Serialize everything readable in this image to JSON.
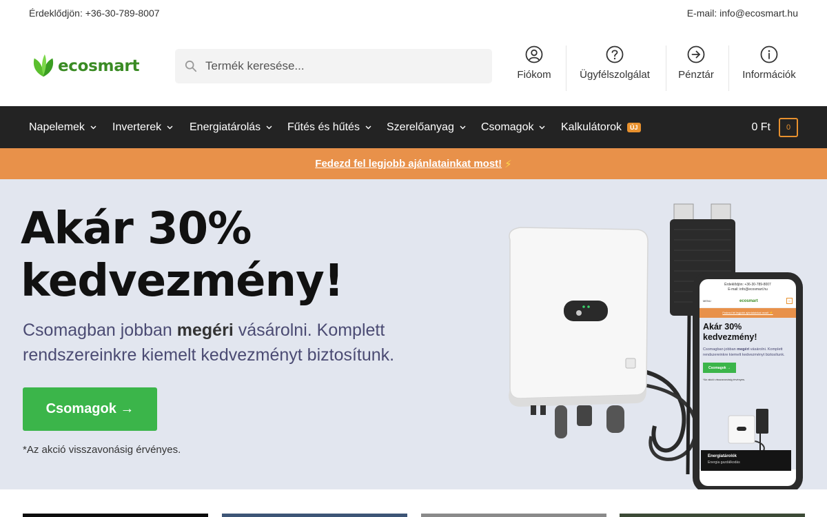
{
  "topbar": {
    "phone": "Érdeklődjön: +36-30-789-8007",
    "email": "E-mail: info@ecosmart.hu"
  },
  "header": {
    "logo_text": "ecosmart",
    "search_placeholder": "Termék keresése...",
    "nav": [
      {
        "label": "Fiókom",
        "icon": "user-circle-icon"
      },
      {
        "label": "Ügyfélszolgálat",
        "icon": "question-circle-icon"
      },
      {
        "label": "Pénztár",
        "icon": "arrow-right-circle-icon"
      },
      {
        "label": "Információk",
        "icon": "info-circle-icon"
      }
    ]
  },
  "mainnav": {
    "items": [
      {
        "label": "Napelemek"
      },
      {
        "label": "Inverterek"
      },
      {
        "label": "Energiatárolás"
      },
      {
        "label": "Fűtés és hűtés"
      },
      {
        "label": "Szerelőanyag"
      },
      {
        "label": "Csomagok"
      },
      {
        "label": "Kalkulátorok"
      }
    ],
    "new_badge": "ÚJ",
    "cart_total": "0 Ft",
    "cart_count": "0"
  },
  "promo": {
    "text": "Fedezd fel legjobb ajánlatainkat most!",
    "emoji": "⚡"
  },
  "hero": {
    "title_line1": "Akár 30%",
    "title_line2": "kedvezmény!",
    "sub_pre": "Csomagban jobban ",
    "sub_bold": "megéri",
    "sub_post": " vásárolni. Komplett rendszereinkre kiemelt kedvezményt biztosítunk.",
    "cta": "Csomagok →",
    "note": "*Az akció visszavonásig érvényes."
  },
  "phone_preview": {
    "top_line1": "Érdeklődjön: +36-30-789-8007",
    "top_line2": "E-mail: info@ecosmart.hu",
    "menu": "MENU",
    "logo": "ecosmart",
    "cart": "0",
    "promo": "Fedezd fel legjobb ajánlatainkat most! ⚡",
    "title_line1": "Akár 30%",
    "title_line2": "kedvezmény!",
    "sub_pre": "Csomagban jobban ",
    "sub_bold": "megéri",
    "sub_post": " vásárolni. Komplett rendszereinkre kiemelt kedvezményt biztosítunk.",
    "cta": "Csomagok →",
    "note": "*Az akció visszavonásig érvényes.",
    "dark_title": "Energiatárolók",
    "dark_sub": "Energia gazdálkodás"
  },
  "colors": {
    "accent_orange": "#e8914a",
    "cta_green": "#3bb54a",
    "nav_dark": "#232323",
    "hero_bg": "#e2e6ef",
    "brand_green": "#3a8b24"
  }
}
